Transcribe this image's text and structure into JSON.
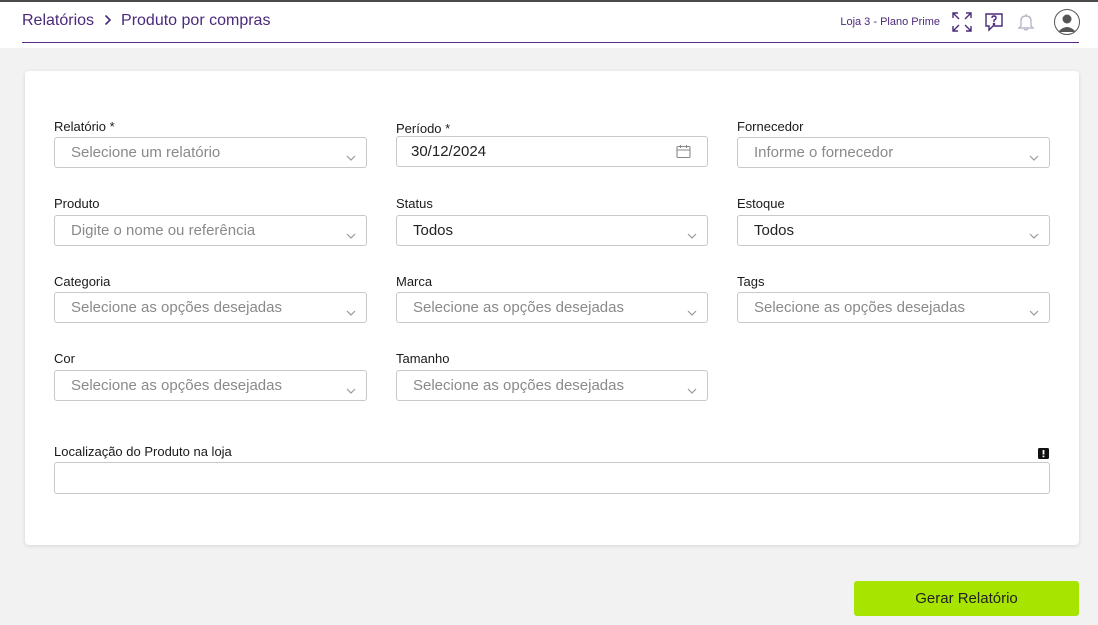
{
  "breadcrumb": {
    "parent": "Relatórios",
    "current": "Produto por compras"
  },
  "header": {
    "store": "Loja 3 - Plano Prime"
  },
  "form": {
    "relatorio": {
      "label": "Relatório *",
      "placeholder": "Selecione um relatório"
    },
    "periodo": {
      "label": "Período *",
      "value": "30/12/2024"
    },
    "fornecedor": {
      "label": "Fornecedor",
      "placeholder": "Informe o fornecedor"
    },
    "produto": {
      "label": "Produto",
      "placeholder": "Digite o nome ou referência"
    },
    "status": {
      "label": "Status",
      "value": "Todos"
    },
    "estoque": {
      "label": "Estoque",
      "value": "Todos"
    },
    "categoria": {
      "label": "Categoria",
      "placeholder": "Selecione as opções desejadas"
    },
    "marca": {
      "label": "Marca",
      "placeholder": "Selecione as opções desejadas"
    },
    "tags": {
      "label": "Tags",
      "placeholder": "Selecione as opções desejadas"
    },
    "cor": {
      "label": "Cor",
      "placeholder": "Selecione as opções desejadas"
    },
    "tamanho": {
      "label": "Tamanho",
      "placeholder": "Selecione as opções desejadas"
    },
    "localizacao": {
      "label": "Localização do Produto na loja",
      "value": ""
    }
  },
  "actions": {
    "generate": "Gerar Relatório"
  },
  "colors": {
    "accent": "#4b2a7b",
    "button": "#a7e400",
    "background": "#f2f2f2"
  }
}
